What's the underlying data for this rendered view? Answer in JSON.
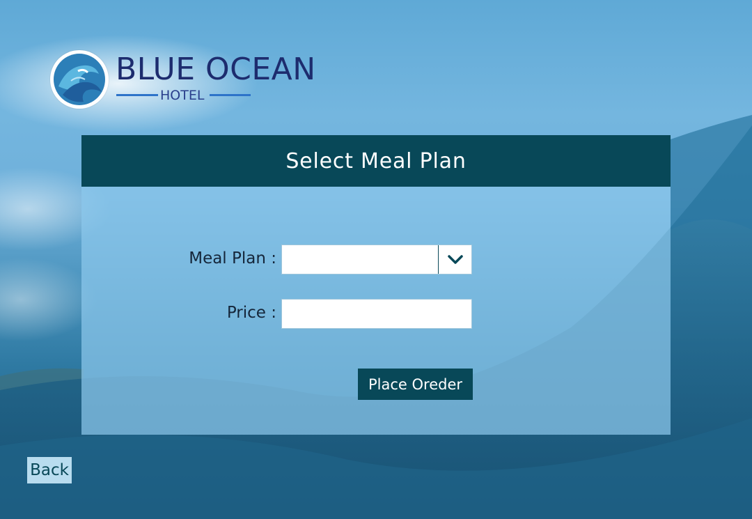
{
  "brand": {
    "name": "BLUE OCEAN",
    "subtitle": "HOTEL",
    "logo_icon": "wave-logo-icon",
    "colors": {
      "name": "#1d2c6e",
      "accent_line": "#2d73c9"
    }
  },
  "panel": {
    "title": "Select Meal Plan",
    "header_color": "#084858"
  },
  "form": {
    "meal_plan": {
      "label": "Meal Plan :",
      "value": "",
      "icon": "chevron-down-icon"
    },
    "price": {
      "label": "Price :",
      "value": ""
    },
    "submit_label": "Place Oreder"
  },
  "nav": {
    "back_label": "Back"
  }
}
